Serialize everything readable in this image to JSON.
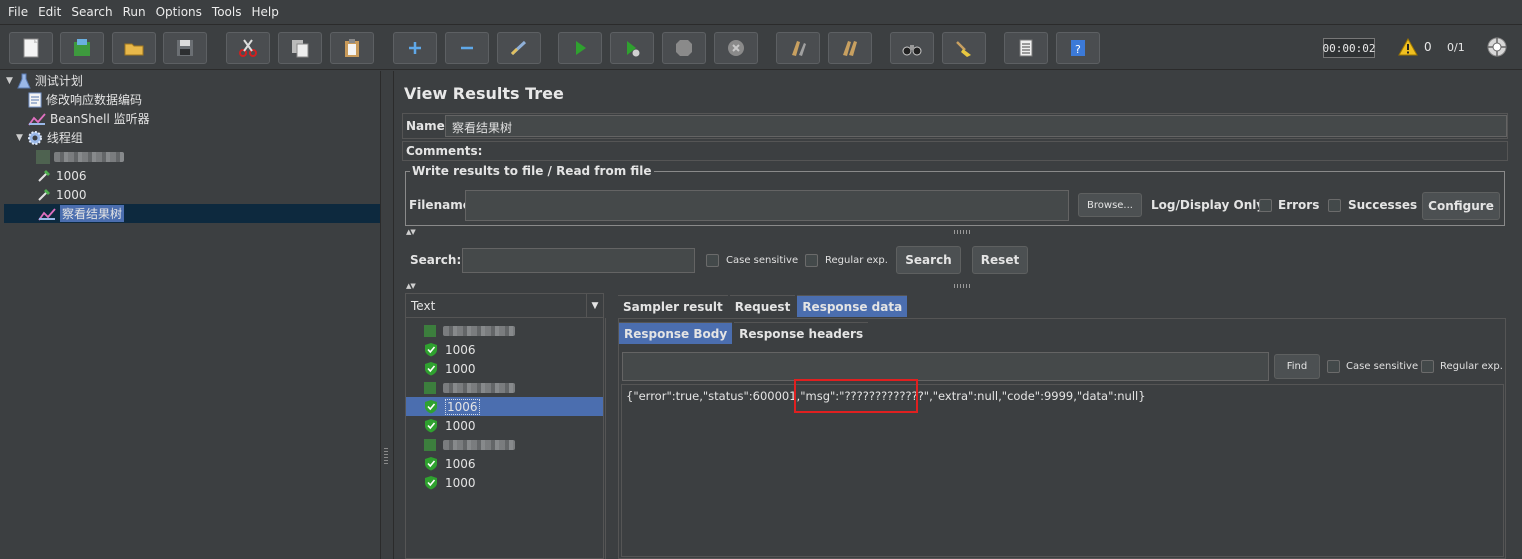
{
  "menu": [
    "File",
    "Edit",
    "Search",
    "Run",
    "Options",
    "Tools",
    "Help"
  ],
  "toolbar": {
    "timer": "00:00:02",
    "warnings": "0",
    "threads": "0/1"
  },
  "tree": {
    "plan": "测试计划",
    "encode": "修改响应数据编码",
    "beanshell": "BeanShell 监听器",
    "group": "线程组",
    "req1006": "1006",
    "req1000": "1000",
    "viewer": "察看结果树"
  },
  "panel": {
    "title": "View Results Tree",
    "name_label": "Name:",
    "name_value": "察看结果树",
    "comments_label": "Comments:",
    "file_legend": "Write results to file / Read from file",
    "filename_label": "Filename",
    "browse": "Browse...",
    "log_only": "Log/Display Only:",
    "errors": "Errors",
    "successes": "Successes",
    "configure": "Configure",
    "search_label": "Search:",
    "case_sensitive": "Case sensitive",
    "regular_exp": "Regular exp.",
    "search_btn": "Search",
    "reset_btn": "Reset"
  },
  "results": {
    "renderer": "Text",
    "items": [
      "1006",
      "1000",
      "1006",
      "1000",
      "1006",
      "1000"
    ]
  },
  "tabs": {
    "sampler": "Sampler result",
    "request": "Request",
    "response": "Response data",
    "body": "Response Body",
    "headers": "Response headers",
    "find": "Find",
    "case_sensitive": "Case sensitive",
    "regular_exp": "Regular exp."
  },
  "response_text": "{\"error\":true,\"status\":600001,\"msg\":\"?????????????\",\"extra\":null,\"code\":9999,\"data\":null}"
}
